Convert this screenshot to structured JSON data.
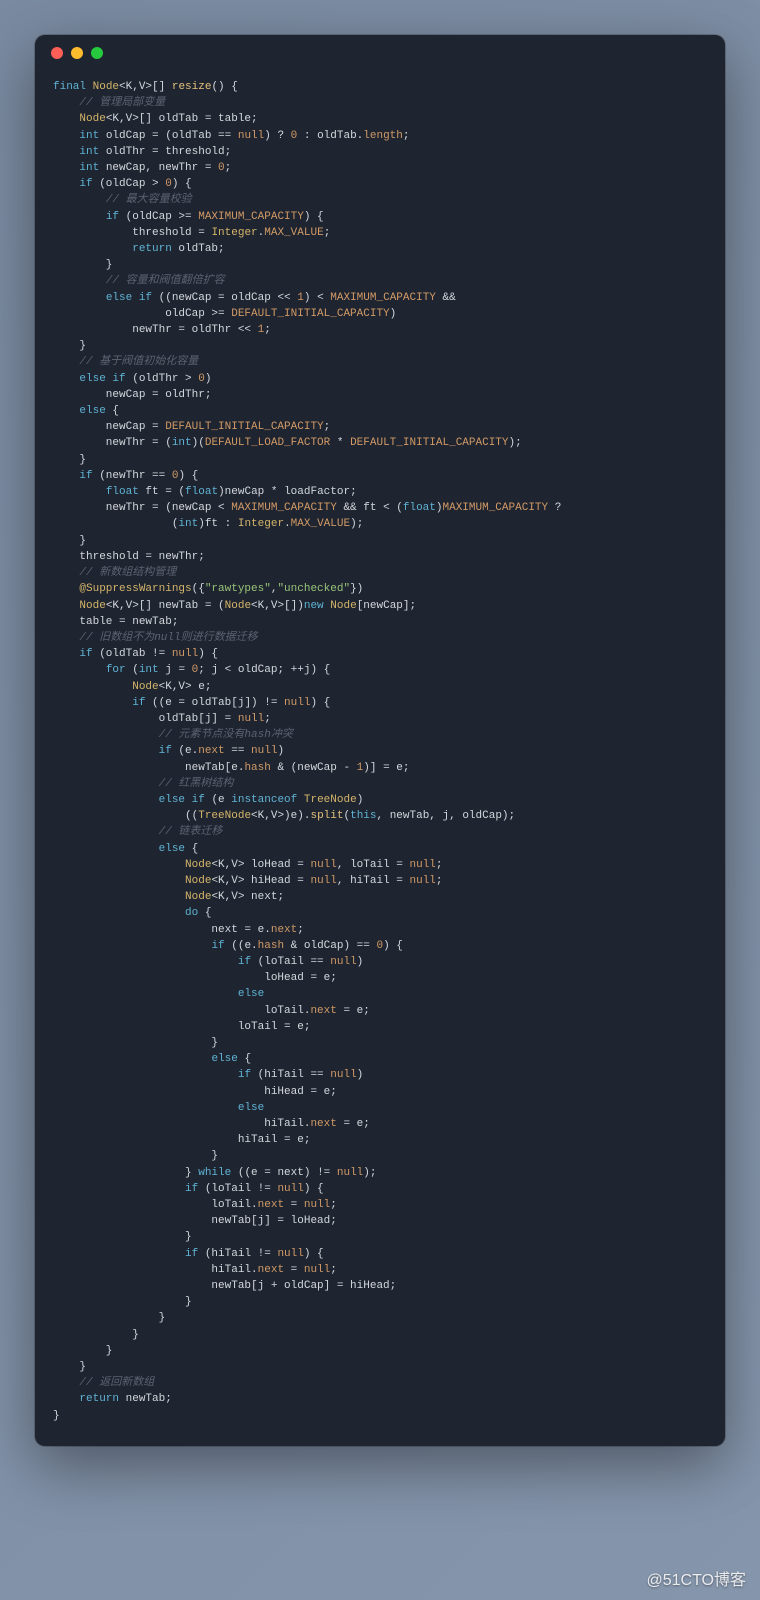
{
  "window_controls": {
    "close": "red",
    "minimize": "yellow",
    "maximize": "green"
  },
  "watermark": "@51CTO博客",
  "code": {
    "l1": "final Node<K,V>[] resize() {",
    "l2": "    // 管理局部变量",
    "l3": "    Node<K,V>[] oldTab = table;",
    "l4": "    int oldCap = (oldTab == null) ? 0 : oldTab.length;",
    "l5": "    int oldThr = threshold;",
    "l6": "    int newCap, newThr = 0;",
    "l7": "    if (oldCap > 0) {",
    "l8": "        // 最大容量校验",
    "l9": "        if (oldCap >= MAXIMUM_CAPACITY) {",
    "l10": "            threshold = Integer.MAX_VALUE;",
    "l11": "            return oldTab;",
    "l12": "        }",
    "l13": "        // 容量和阀值翻倍扩容",
    "l14": "        else if ((newCap = oldCap << 1) < MAXIMUM_CAPACITY &&",
    "l15": "                 oldCap >= DEFAULT_INITIAL_CAPACITY)",
    "l16": "            newThr = oldThr << 1;",
    "l17": "    }",
    "l18": "    // 基于阀值初始化容量",
    "l19": "    else if (oldThr > 0)",
    "l20": "        newCap = oldThr;",
    "l21": "    else {",
    "l22": "        newCap = DEFAULT_INITIAL_CAPACITY;",
    "l23": "        newThr = (int)(DEFAULT_LOAD_FACTOR * DEFAULT_INITIAL_CAPACITY);",
    "l24": "    }",
    "l25": "    if (newThr == 0) {",
    "l26": "        float ft = (float)newCap * loadFactor;",
    "l27": "        newThr = (newCap < MAXIMUM_CAPACITY && ft < (float)MAXIMUM_CAPACITY ?",
    "l28": "                  (int)ft : Integer.MAX_VALUE);",
    "l29": "    }",
    "l30": "    threshold = newThr;",
    "l31": "    // 新数组结构管理",
    "l32": "    @SuppressWarnings({\"rawtypes\",\"unchecked\"})",
    "l33": "    Node<K,V>[] newTab = (Node<K,V>[])new Node[newCap];",
    "l34": "    table = newTab;",
    "l35": "    // 旧数组不为null则进行数据迁移",
    "l36": "    if (oldTab != null) {",
    "l37": "        for (int j = 0; j < oldCap; ++j) {",
    "l38": "            Node<K,V> e;",
    "l39": "            if ((e = oldTab[j]) != null) {",
    "l40": "                oldTab[j] = null;",
    "l41": "                // 元素节点没有hash冲突",
    "l42": "                if (e.next == null)",
    "l43": "                    newTab[e.hash & (newCap - 1)] = e;",
    "l44": "                // 红黑树结构",
    "l45": "                else if (e instanceof TreeNode)",
    "l46": "                    ((TreeNode<K,V>)e).split(this, newTab, j, oldCap);",
    "l47": "                // 链表迁移",
    "l48": "                else {",
    "l49": "                    Node<K,V> loHead = null, loTail = null;",
    "l50": "                    Node<K,V> hiHead = null, hiTail = null;",
    "l51": "                    Node<K,V> next;",
    "l52": "                    do {",
    "l53": "                        next = e.next;",
    "l54": "                        if ((e.hash & oldCap) == 0) {",
    "l55": "                            if (loTail == null)",
    "l56": "                                loHead = e;",
    "l57": "                            else",
    "l58": "                                loTail.next = e;",
    "l59": "                            loTail = e;",
    "l60": "                        }",
    "l61": "                        else {",
    "l62": "                            if (hiTail == null)",
    "l63": "                                hiHead = e;",
    "l64": "                            else",
    "l65": "                                hiTail.next = e;",
    "l66": "                            hiTail = e;",
    "l67": "                        }",
    "l68": "                    } while ((e = next) != null);",
    "l69": "                    if (loTail != null) {",
    "l70": "                        loTail.next = null;",
    "l71": "                        newTab[j] = loHead;",
    "l72": "                    }",
    "l73": "                    if (hiTail != null) {",
    "l74": "                        hiTail.next = null;",
    "l75": "                        newTab[j + oldCap] = hiHead;",
    "l76": "                    }",
    "l77": "                }",
    "l78": "            }",
    "l79": "        }",
    "l80": "    }",
    "l81": "    // 返回新数组",
    "l82": "    return newTab;",
    "l83": "}"
  }
}
